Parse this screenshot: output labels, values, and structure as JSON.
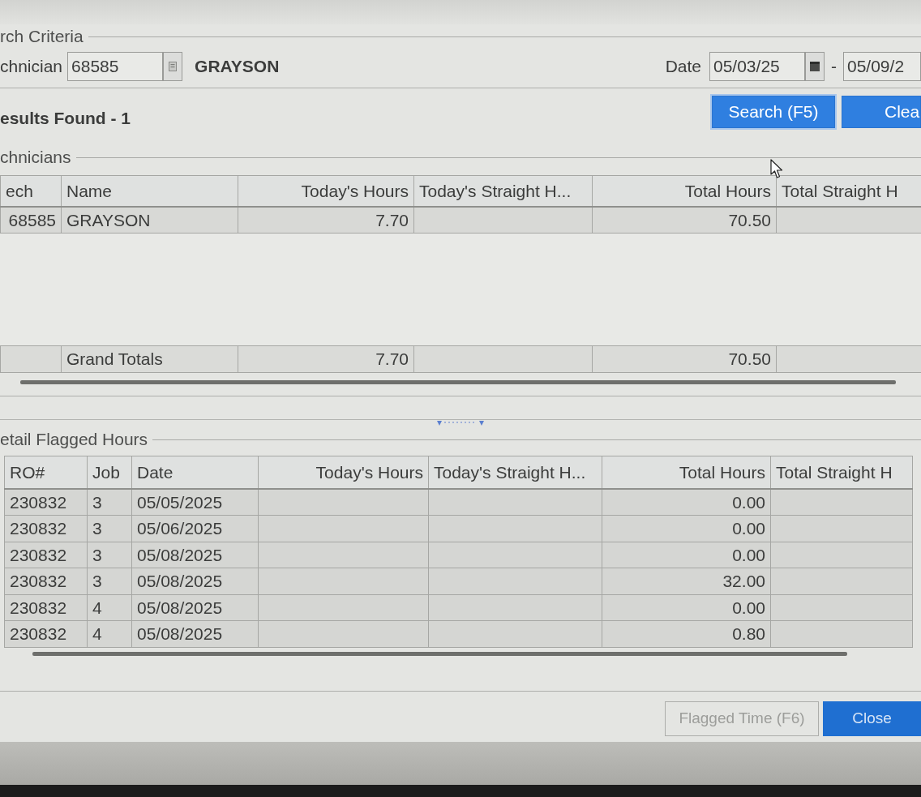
{
  "search_criteria": {
    "legend": "rch Criteria",
    "technician_label": "chnician",
    "technician_id": "68585",
    "technician_name": "GRAYSON",
    "date_label": "Date",
    "date_from": "05/03/25",
    "date_separator": "-",
    "date_to": "05/09/2"
  },
  "results": {
    "summary": "esults Found - 1",
    "buttons": [
      {
        "label": "Search (F5)",
        "focused": true
      },
      {
        "label": "Clea",
        "focused": false
      }
    ]
  },
  "technicians": {
    "legend": "chnicians",
    "columns": [
      {
        "label": "ech",
        "kind": "id"
      },
      {
        "label": "Name",
        "kind": "text"
      },
      {
        "label": "Today's Hours",
        "kind": "numeric"
      },
      {
        "label": "Today's Straight H...",
        "kind": "text"
      },
      {
        "label": "Total Hours",
        "kind": "numeric"
      },
      {
        "label": "Total Straight H",
        "kind": "text"
      }
    ],
    "rows": [
      {
        "tech": "68585",
        "name": "GRAYSON",
        "todays_hours": "7.70",
        "total_hours": "70.50"
      }
    ],
    "totals": {
      "label": "Grand Totals",
      "todays_hours": "7.70",
      "total_hours": "70.50"
    }
  },
  "detail_flagged_hours": {
    "legend": "etail Flagged Hours",
    "columns": [
      {
        "label": "RO#",
        "kind": "text"
      },
      {
        "label": "Job",
        "kind": "text"
      },
      {
        "label": "Date",
        "kind": "text"
      },
      {
        "label": "Today's Hours",
        "kind": "numeric"
      },
      {
        "label": "Today's Straight H...",
        "kind": "text"
      },
      {
        "label": "Total Hours",
        "kind": "numeric"
      },
      {
        "label": "Total Straight H",
        "kind": "text"
      }
    ],
    "rows": [
      {
        "ro": "230832",
        "job": "3",
        "date": "05/05/2025",
        "total_hours": "0.00"
      },
      {
        "ro": "230832",
        "job": "3",
        "date": "05/06/2025",
        "total_hours": "0.00"
      },
      {
        "ro": "230832",
        "job": "3",
        "date": "05/08/2025",
        "total_hours": "0.00"
      },
      {
        "ro": "230832",
        "job": "3",
        "date": "05/08/2025",
        "total_hours": "32.00"
      },
      {
        "ro": "230832",
        "job": "4",
        "date": "05/08/2025",
        "total_hours": "0.00"
      },
      {
        "ro": "230832",
        "job": "4",
        "date": "05/08/2025",
        "total_hours": "0.80"
      }
    ]
  },
  "footer_buttons": [
    {
      "label": "Flagged Time (F6)",
      "disabled": true
    },
    {
      "label": "Close",
      "disabled": false
    }
  ]
}
